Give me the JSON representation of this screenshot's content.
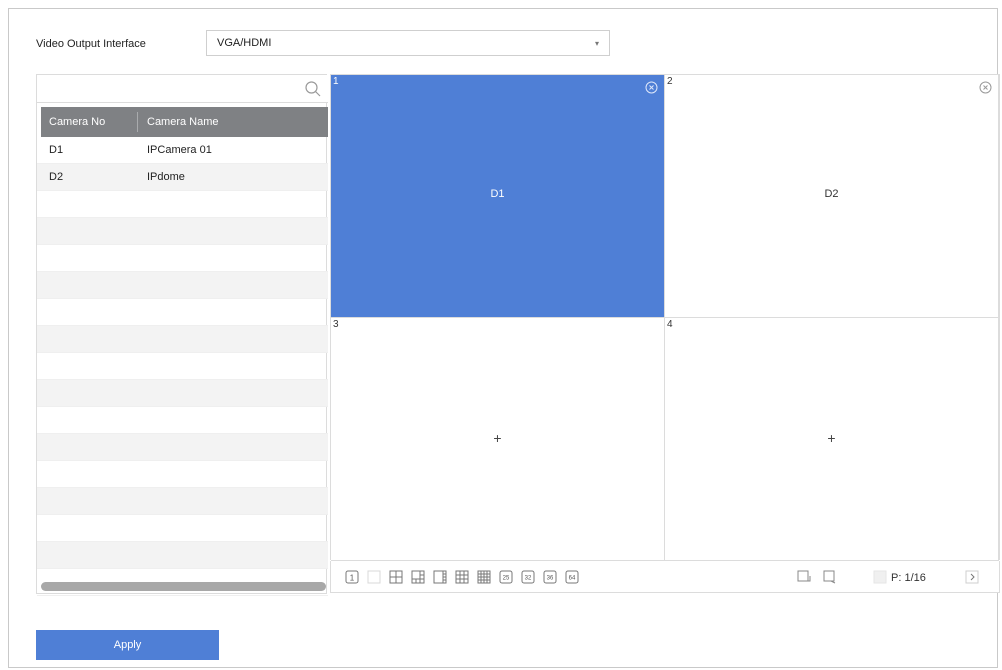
{
  "header": {
    "output_label": "Video Output Interface",
    "output_value": "VGA/HDMI"
  },
  "table": {
    "columns": [
      "Camera No",
      "Camera Name"
    ],
    "rows": [
      {
        "no": "D1",
        "name": "IPCamera 01"
      },
      {
        "no": "D2",
        "name": "IPdome"
      },
      {
        "no": "",
        "name": ""
      },
      {
        "no": "",
        "name": ""
      },
      {
        "no": "",
        "name": ""
      },
      {
        "no": "",
        "name": ""
      },
      {
        "no": "",
        "name": ""
      },
      {
        "no": "",
        "name": ""
      },
      {
        "no": "",
        "name": ""
      },
      {
        "no": "",
        "name": ""
      },
      {
        "no": "",
        "name": ""
      },
      {
        "no": "",
        "name": ""
      },
      {
        "no": "",
        "name": ""
      },
      {
        "no": "",
        "name": ""
      },
      {
        "no": "",
        "name": ""
      },
      {
        "no": "",
        "name": ""
      },
      {
        "no": "",
        "name": ""
      }
    ]
  },
  "tiles": [
    {
      "num": "1",
      "camera": "D1",
      "selected": true
    },
    {
      "num": "2",
      "camera": "D2",
      "selected": false
    },
    {
      "num": "3",
      "camera": "",
      "selected": false
    },
    {
      "num": "4",
      "camera": "",
      "selected": false
    }
  ],
  "toolbar": {
    "layouts": [
      "1",
      "4",
      "6",
      "8",
      "8",
      "9",
      "16",
      "25",
      "32",
      "36",
      "64"
    ],
    "layout_icons": [
      "layout-1-icon",
      "layout-4-icon",
      "layout-6-icon",
      "layout-8-icon",
      "layout-8b-icon",
      "layout-9-icon",
      "layout-16-icon",
      "layout-25-icon",
      "layout-32-icon",
      "layout-36-icon",
      "layout-64-icon"
    ],
    "page": "P: 1/16"
  },
  "apply_label": "Apply",
  "colors": {
    "accent": "#4f7fd6",
    "header_gray": "#7f8184"
  }
}
